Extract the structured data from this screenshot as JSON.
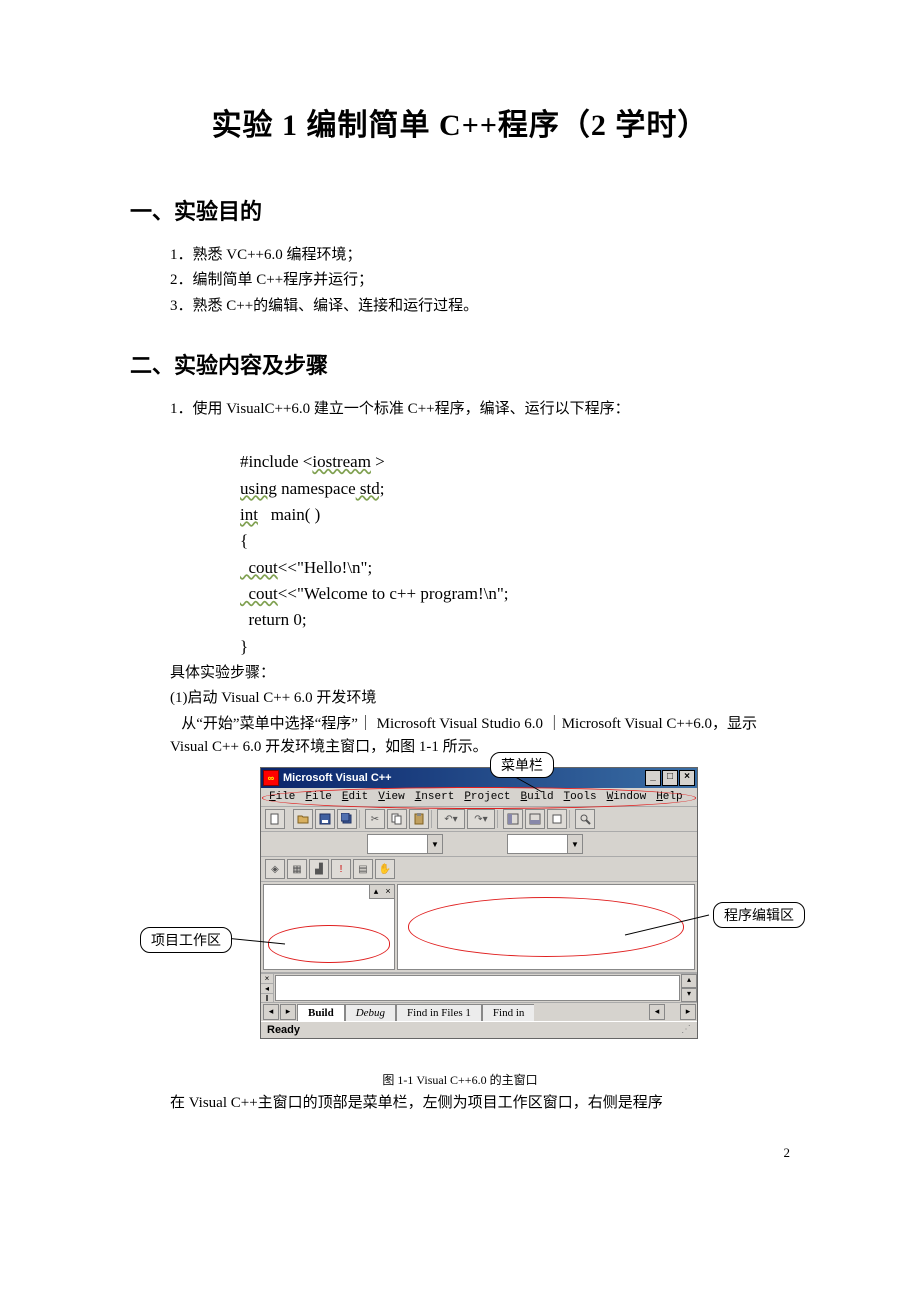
{
  "title": "实验 1   编制简单 C++程序（2 学时）",
  "section1": "一、实验目的",
  "objectives": [
    "1．熟悉 VC++6.0 编程环境；",
    "2．编制简单 C++程序并运行；",
    "3．熟悉 C++的编辑、编译、连接和运行过程。"
  ],
  "section2": "二、实验内容及步骤",
  "task1": "1．使用 VisualC++6.0 建立一个标准 C++程序，编译、运行以下程序：",
  "code": {
    "l1a": "#include <",
    "l1b": "iostream",
    "l1c": " >",
    "l2a": "using",
    "l2b": " namespace",
    "l2c": " std;",
    "l3a": "int",
    "l3b": "   main( )",
    "l4": "{",
    "l5a": "  cout",
    "l5b": "<<\"Hello!\\n\";",
    "l6a": "  cout",
    "l6b": "<<\"Welcome to c++ program!\\n\";",
    "l7": "  return 0;",
    "l8": "}"
  },
  "steps_hdr": "具体实验步骤：",
  "step1_title": "(1)启动 Visual C++ 6.0 开发环境",
  "step1_body": "   从“开始”菜单中选择“程序”｜ Microsoft Visual Studio 6.0 ｜Microsoft Visual C++6.0，显示 Visual C++ 6.0 开发环境主窗口，如图 1-1 所示。",
  "callouts": {
    "menubar": "菜单栏",
    "workspace": "项目工作区",
    "editor": "程序编辑区"
  },
  "win": {
    "title": "Microsoft Visual C++",
    "menus": [
      {
        "u": "F",
        "rest": "ile"
      },
      {
        "u": "F",
        "rest": "ile"
      },
      {
        "u": "E",
        "rest": "dit"
      },
      {
        "u": "V",
        "rest": "iew"
      },
      {
        "u": "I",
        "rest": "nsert"
      },
      {
        "u": "P",
        "rest": "roject"
      },
      {
        "u": "B",
        "rest": "uild"
      },
      {
        "u": "T",
        "rest": "ools"
      },
      {
        "u": "W",
        "rest": "indow"
      },
      {
        "u": "H",
        "rest": "elp"
      }
    ],
    "tabs": {
      "build": "Build",
      "debug": "Debug",
      "find": "Find in Files 1",
      "findpart": "Find in"
    },
    "status": "Ready"
  },
  "caption": "图 1-1 Visual C++6.0 的主窗口",
  "cont": "   在 Visual C++主窗口的顶部是菜单栏，左侧为项目工作区窗口，右侧是程序",
  "pagenum": "2"
}
